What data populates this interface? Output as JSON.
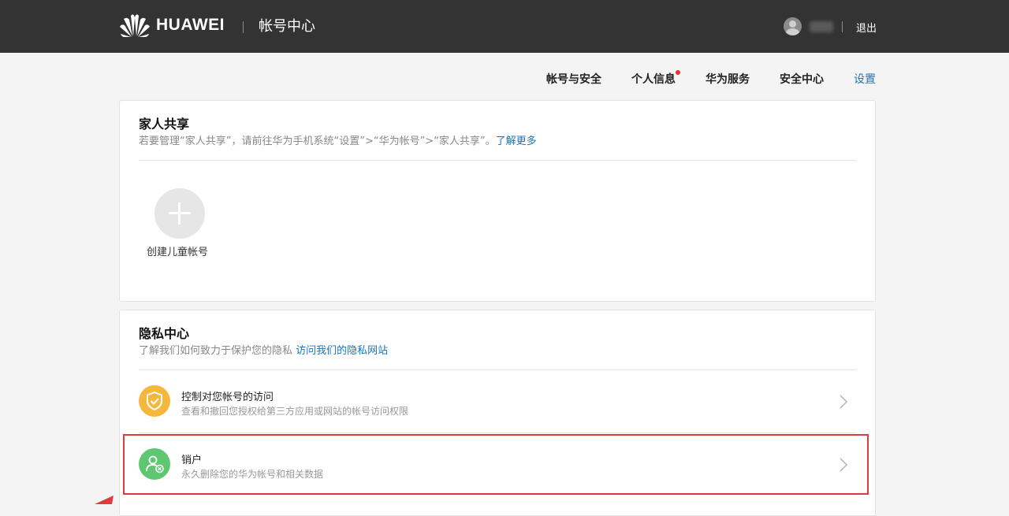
{
  "header": {
    "brand": "HUAWEI",
    "app_title": "帐号中心",
    "logout": "退出"
  },
  "nav": {
    "items": [
      {
        "label": "帐号与安全"
      },
      {
        "label": "个人信息",
        "badge": "red-dot"
      },
      {
        "label": "华为服务"
      },
      {
        "label": "安全中心"
      },
      {
        "label": "设置",
        "active": true
      }
    ]
  },
  "family_sharing": {
    "title": "家人共享",
    "desc": "若要管理“家人共享”，请前往华为手机系统“设置”>“华为帐号”>“家人共享”。",
    "link": "了解更多",
    "add_label": "创建儿童帐号"
  },
  "privacy": {
    "title": "隐私中心",
    "desc": "了解我们如何致力于保护您的隐私",
    "link": "访问我们的隐私网站",
    "rows": [
      {
        "title": "控制对您帐号的访问",
        "subtitle": "查看和撤回您授权给第三方应用或网站的帐号访问权限",
        "icon": "shield-check-icon",
        "color": "#f5b83d"
      },
      {
        "title": "销户",
        "subtitle": "永久删除您的华为帐号和相关数据",
        "icon": "user-remove-icon",
        "color": "#5ec770"
      }
    ]
  },
  "colors": {
    "header_bg": "#333333",
    "accent": "#1a75bb",
    "highlight": "#e03b3b"
  }
}
